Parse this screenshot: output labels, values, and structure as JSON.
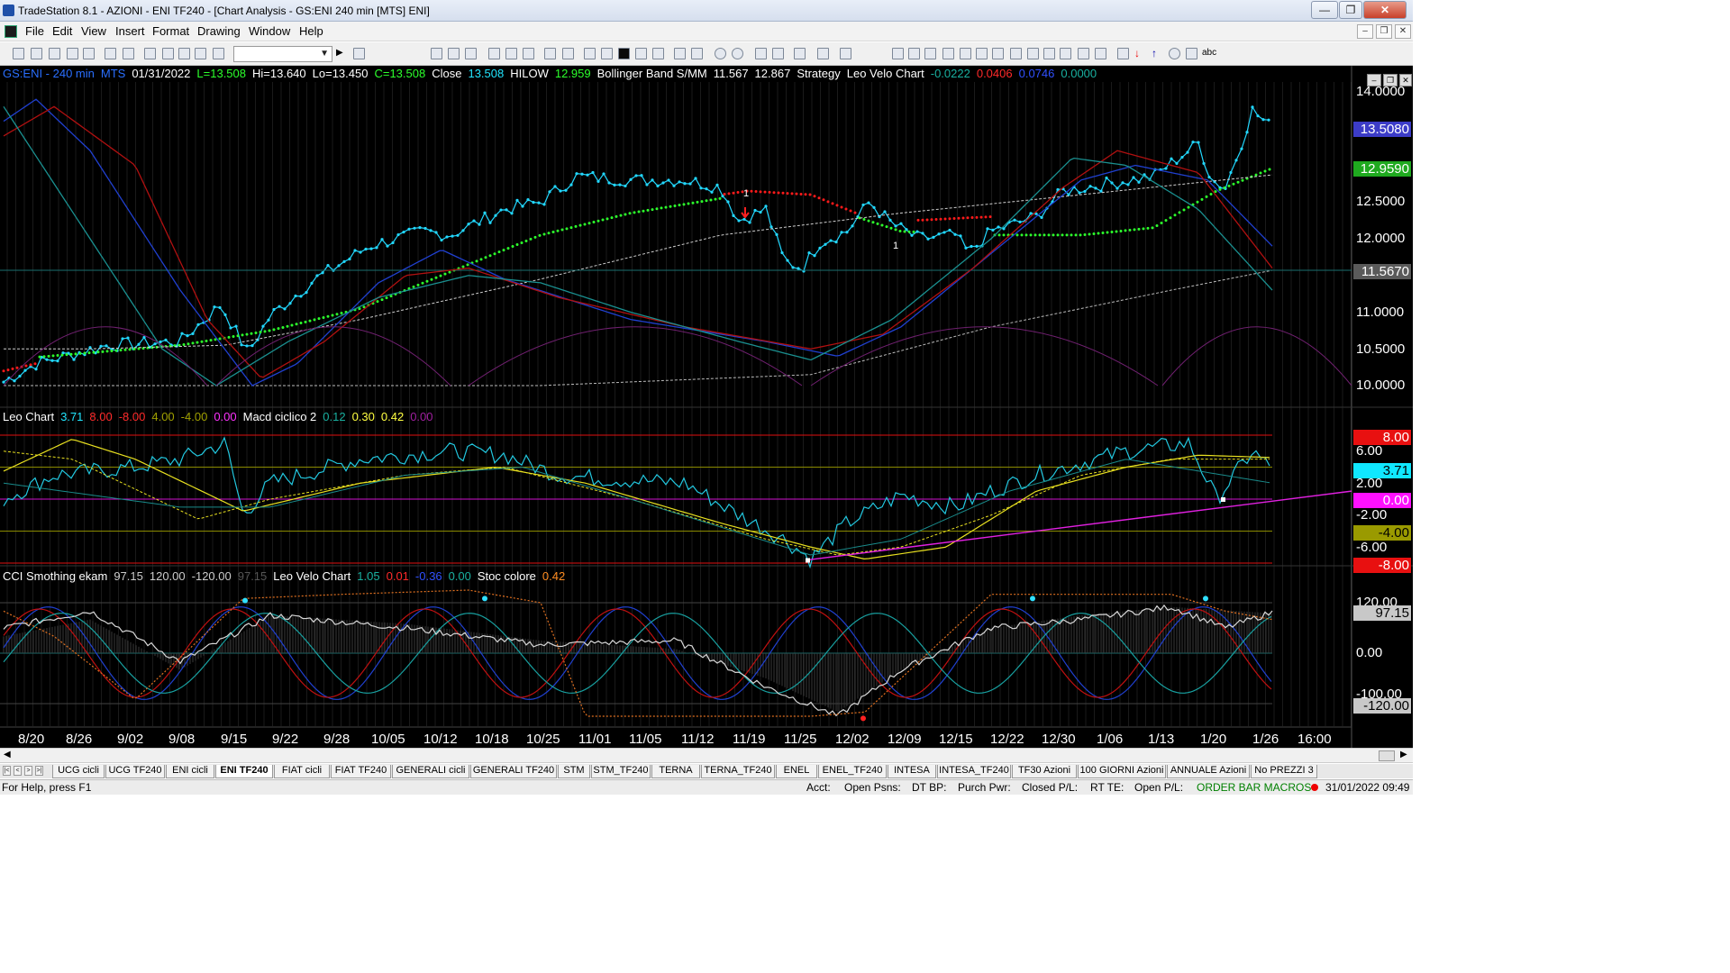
{
  "window": {
    "title": "TradeStation 8.1 - AZIONI - ENI TF240 - [Chart Analysis - GS:ENI  240 min  [MTS] ENI]"
  },
  "menu": [
    "File",
    "Edit",
    "View",
    "Insert",
    "Format",
    "Drawing",
    "Window",
    "Help"
  ],
  "panel1": {
    "items": [
      {
        "text": "GS:ENI - 240 min",
        "color": "#2a6fff"
      },
      {
        "text": "MTS",
        "color": "#2a6fff"
      },
      {
        "text": "01/31/2022",
        "color": "#ffffff"
      },
      {
        "text": "L=13.508",
        "color": "#2cff2c"
      },
      {
        "text": "Hi=13.640",
        "color": "#ffffff"
      },
      {
        "text": "Lo=13.450",
        "color": "#ffffff"
      },
      {
        "text": "C=13.508",
        "color": "#2cff2c"
      },
      {
        "text": "Close",
        "color": "#ffffff"
      },
      {
        "text": "13.508",
        "color": "#22e6ff"
      },
      {
        "text": "HILOW",
        "color": "#ffffff"
      },
      {
        "text": "12.959",
        "color": "#2cff2c"
      },
      {
        "text": "Bollinger Band S/MM",
        "color": "#ffffff"
      },
      {
        "text": "11.567",
        "color": "#ffffff"
      },
      {
        "text": "12.867",
        "color": "#ffffff"
      },
      {
        "text": "Strategy",
        "color": "#ffffff"
      },
      {
        "text": "Leo Velo Chart",
        "color": "#ffffff"
      },
      {
        "text": "-0.0222",
        "color": "#19b0a0"
      },
      {
        "text": "0.0406",
        "color": "#ff2a2a"
      },
      {
        "text": "0.0746",
        "color": "#3050ff"
      },
      {
        "text": "0.0000",
        "color": "#19b0a0"
      }
    ],
    "axis": [
      "14.0000",
      "12.5000",
      "12.0000",
      "11.0000",
      "10.5000",
      "10.0000"
    ],
    "tags": [
      {
        "text": "13.5080",
        "bg": "#3c3cc8",
        "fg": "#ffffff"
      },
      {
        "text": "12.9590",
        "bg": "#1faa1f",
        "fg": "#ffffff"
      },
      {
        "text": "11.5670",
        "bg": "#5a5a5a",
        "fg": "#ffffff"
      }
    ],
    "markers": [
      "1",
      "1"
    ]
  },
  "panel2": {
    "items": [
      {
        "text": "Leo Chart",
        "color": "#ffffff"
      },
      {
        "text": "3.71",
        "color": "#22e6ff"
      },
      {
        "text": "8.00",
        "color": "#ff2a2a"
      },
      {
        "text": "-8.00",
        "color": "#ff2a2a"
      },
      {
        "text": "4.00",
        "color": "#a0a000"
      },
      {
        "text": "-4.00",
        "color": "#a0a000"
      },
      {
        "text": "0.00",
        "color": "#ff33ff"
      },
      {
        "text": "Macd ciclico 2",
        "color": "#ffffff"
      },
      {
        "text": "0.12",
        "color": "#19b0a0"
      },
      {
        "text": "0.30",
        "color": "#ffff40"
      },
      {
        "text": "0.42",
        "color": "#ffff40"
      },
      {
        "text": "0.00",
        "color": "#a020a0"
      }
    ],
    "axis": [
      "6.00",
      "2.00",
      "-2.00",
      "-6.00"
    ],
    "tags": [
      {
        "text": "8.00",
        "bg": "#e81010",
        "fg": "#ffffff"
      },
      {
        "text": "3.71",
        "bg": "#10e8ff",
        "fg": "#000000"
      },
      {
        "text": "0.00",
        "bg": "#ff10ff",
        "fg": "#ffffff"
      },
      {
        "text": "-4.00",
        "bg": "#9a9a00",
        "fg": "#000000"
      },
      {
        "text": "-8.00",
        "bg": "#e81010",
        "fg": "#ffffff"
      }
    ]
  },
  "panel3": {
    "items": [
      {
        "text": "CCI Smothing ekam",
        "color": "#ffffff"
      },
      {
        "text": "97.15",
        "color": "#cccccc"
      },
      {
        "text": "120.00",
        "color": "#cccccc"
      },
      {
        "text": "-120.00",
        "color": "#cccccc"
      },
      {
        "text": "97.15",
        "color": "#555555"
      },
      {
        "text": "Leo Velo Chart",
        "color": "#ffffff"
      },
      {
        "text": "1.05",
        "color": "#19b0a0"
      },
      {
        "text": "0.01",
        "color": "#ff2a2a"
      },
      {
        "text": "-0.36",
        "color": "#3050ff"
      },
      {
        "text": "0.00",
        "color": "#19b0a0"
      },
      {
        "text": "Stoc colore",
        "color": "#ffffff"
      },
      {
        "text": "0.42",
        "color": "#ff8c20"
      }
    ],
    "axis": [
      "120.00",
      "0.00",
      "-100.00"
    ],
    "tags": [
      {
        "text": "97.15",
        "bg": "#c8c8c8",
        "fg": "#000000"
      },
      {
        "text": "-120.00",
        "bg": "#c8c8c8",
        "fg": "#000000"
      }
    ]
  },
  "dates": [
    "8/20",
    "8/26",
    "9/02",
    "9/08",
    "9/15",
    "9/22",
    "9/28",
    "10/05",
    "10/12",
    "10/18",
    "10/25",
    "11/01",
    "11/05",
    "11/12",
    "11/19",
    "11/25",
    "12/02",
    "12/09",
    "12/15",
    "12/22",
    "12/30",
    "1/06",
    "1/13",
    "1/20",
    "1/26",
    "16:00"
  ],
  "tabs": [
    "UCG cicli",
    "UCG TF240",
    "ENI cicli",
    "ENI TF240",
    "FIAT cicli",
    "FIAT TF240",
    "GENERALI cicli",
    "GENERALI TF240",
    "STM",
    "STM_TF240",
    "TERNA",
    "TERNA_TF240",
    "ENEL",
    "ENEL_TF240",
    "INTESA",
    "INTESA_TF240",
    "TF30 Azioni",
    "100 GIORNI Azioni",
    "ANNUALE Azioni",
    "No PREZZI 3"
  ],
  "active_tab": "ENI TF240",
  "status": {
    "help": "For Help, press F1",
    "acct": "Acct:",
    "open_psns": "Open Psns:",
    "dt_bp": "DT BP:",
    "purch_pwr": "Purch Pwr:",
    "closed_pl": "Closed P/L:",
    "rt_te": "RT TE:",
    "open_pl": "Open P/L:",
    "mode": "ORDER BAR  MACROS",
    "datetime": "31/01/2022 09:49"
  },
  "colors": {
    "price": "#22d8ff",
    "hilow": "#2cff2c",
    "strategy_red": "#ff1a1a"
  }
}
